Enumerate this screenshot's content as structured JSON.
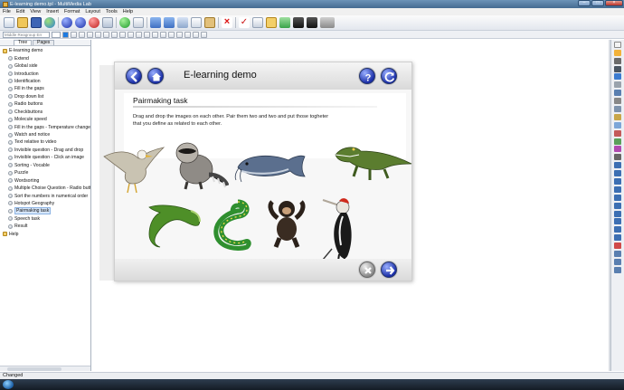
{
  "window": {
    "title": "E-learning demo.tpl - MultiMedia Lab"
  },
  "menu": [
    "File",
    "Edit",
    "View",
    "Insert",
    "Format",
    "Layout",
    "Tools",
    "Help"
  ],
  "format_bar": {
    "font_value": "Middle Reagroup Err"
  },
  "panel_tabs": [
    "Tree",
    "Pages"
  ],
  "tree": [
    {
      "label": "E-learning demo",
      "type": "folder",
      "level": 0
    },
    {
      "label": "Extend",
      "type": "page",
      "level": 1
    },
    {
      "label": "Global side",
      "type": "page",
      "level": 1
    },
    {
      "label": "Introduction",
      "type": "page",
      "level": 1
    },
    {
      "label": "Identification",
      "type": "page",
      "level": 1
    },
    {
      "label": "Fill in the gaps",
      "type": "page",
      "level": 1
    },
    {
      "label": "Drop down list",
      "type": "page",
      "level": 1
    },
    {
      "label": "Radio buttons",
      "type": "page",
      "level": 1
    },
    {
      "label": "Checkbuttons",
      "type": "page",
      "level": 1
    },
    {
      "label": "Molecule speed",
      "type": "page",
      "level": 1
    },
    {
      "label": "Fill in the gaps - Temperature change",
      "type": "page",
      "level": 1
    },
    {
      "label": "Watch and notice",
      "type": "page",
      "level": 1
    },
    {
      "label": "Text relative to video",
      "type": "page",
      "level": 1
    },
    {
      "label": "Invisible question - Drag and drop",
      "type": "page",
      "level": 1
    },
    {
      "label": "Invisible question - Click an image",
      "type": "page",
      "level": 1
    },
    {
      "label": "Sorting - Vocable",
      "type": "page",
      "level": 1
    },
    {
      "label": "Puzzle",
      "type": "page",
      "level": 1
    },
    {
      "label": "Wordsorting",
      "type": "page",
      "level": 1
    },
    {
      "label": "Multiple Choise Question - Radio butt",
      "type": "page",
      "level": 1
    },
    {
      "label": "Sort the numbers in numerical order",
      "type": "page",
      "level": 1
    },
    {
      "label": "Hotspot Geography",
      "type": "page",
      "level": 1
    },
    {
      "label": "Pairmaking task",
      "type": "page",
      "level": 1,
      "selected": true
    },
    {
      "label": "Speech task",
      "type": "page",
      "level": 1
    },
    {
      "label": "Result",
      "type": "page",
      "level": 1
    },
    {
      "label": "Help",
      "type": "folder",
      "level": 0
    }
  ],
  "slide": {
    "header_title": "E-learning demo",
    "task_title": "Pairmaking task",
    "instructions": "Drag and drop the images on each other. Pair them two and two and put those togheter that you define as related to each other."
  },
  "status": {
    "text": "Changed"
  },
  "colors": {
    "nav_button": "#1b2fa8",
    "selection": "#d6e6fa",
    "titlebar": "#456c92"
  }
}
